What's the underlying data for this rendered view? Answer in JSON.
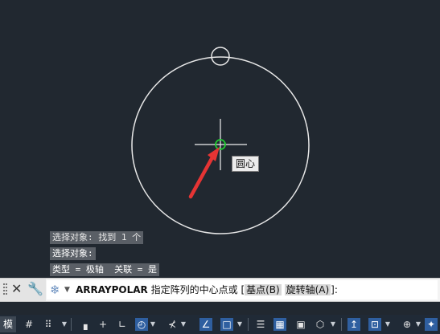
{
  "tooltip": {
    "label": "圆心"
  },
  "history": [
    "选择对象: 找到 1 个",
    "选择对象:",
    "类型 = 极轴  关联 = 是"
  ],
  "command": {
    "name": "ARRAYPOLAR",
    "prompt": "指定阵列的中心点或",
    "open_bracket": "[",
    "options": [
      "基点(B)",
      "旋转轴(A)"
    ],
    "close": "]:"
  },
  "statusbar": {
    "model_tab": "模型"
  },
  "colors": {
    "canvas": "#212830",
    "circle": "#e8e8e8",
    "arrow": "#e53434",
    "snap_marker": "#22cc33",
    "statusbar": "#202a36"
  }
}
